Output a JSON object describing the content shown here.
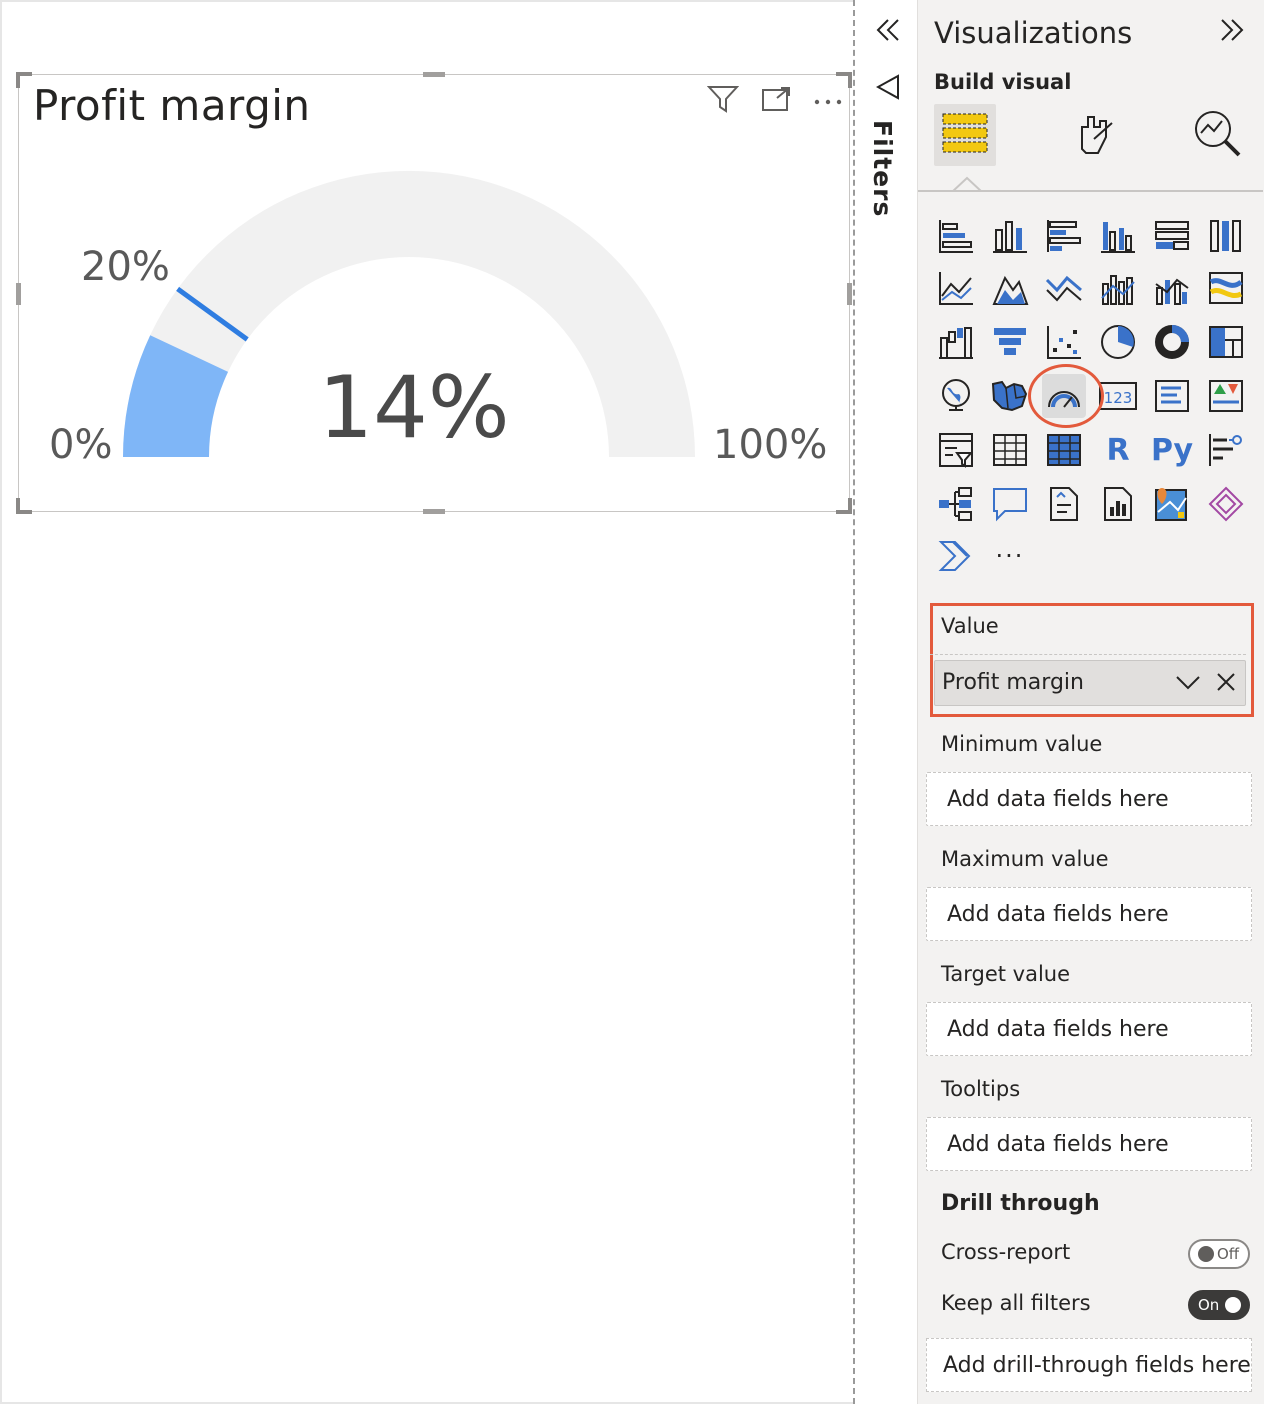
{
  "visual": {
    "title": "Profit margin",
    "toolbar": {
      "filter_icon": "filter-icon",
      "focus_icon": "focus-mode-icon",
      "more_icon": "more-options-icon"
    }
  },
  "chart_data": {
    "type": "gauge",
    "value": 14,
    "value_label": "14%",
    "min": 0,
    "max": 100,
    "target": 20,
    "min_label": "0%",
    "max_label": "100%",
    "target_label": "20%",
    "fill_color": "#7fb6f7",
    "track_color": "#f1f1f1",
    "target_color": "#2f7de1"
  },
  "filters": {
    "label": "Filters",
    "collapse_icon": "double-chevron-left-icon",
    "funnel_icon": "filter-outline-icon"
  },
  "viz_pane": {
    "title": "Visualizations",
    "expand_icon": "double-chevron-right-icon",
    "build_visual": "Build visual",
    "tabs": [
      {
        "name": "fields-tab",
        "icon": "build-visual-icon"
      },
      {
        "name": "format-tab",
        "icon": "format-brush-icon"
      },
      {
        "name": "analytics-tab",
        "icon": "analytics-magnifier-icon"
      }
    ],
    "text_icons": {
      "r": "R",
      "py": "Py"
    },
    "more": "···"
  },
  "wells": {
    "value": {
      "label": "Value",
      "field": "Profit margin"
    },
    "minimum": {
      "label": "Minimum value",
      "placeholder": "Add data fields here"
    },
    "maximum": {
      "label": "Maximum value",
      "placeholder": "Add data fields here"
    },
    "target": {
      "label": "Target value",
      "placeholder": "Add data fields here"
    },
    "tooltips": {
      "label": "Tooltips",
      "placeholder": "Add data fields here"
    }
  },
  "drill_through": {
    "title": "Drill through",
    "cross_report": {
      "label": "Cross-report",
      "state": "Off"
    },
    "keep_all_filters": {
      "label": "Keep all filters",
      "state": "On"
    },
    "placeholder": "Add drill-through fields here"
  },
  "colors": {
    "accent_red": "#e35a3c",
    "icon_blue": "#3a72c9",
    "icon_yellow": "#f2c811"
  }
}
